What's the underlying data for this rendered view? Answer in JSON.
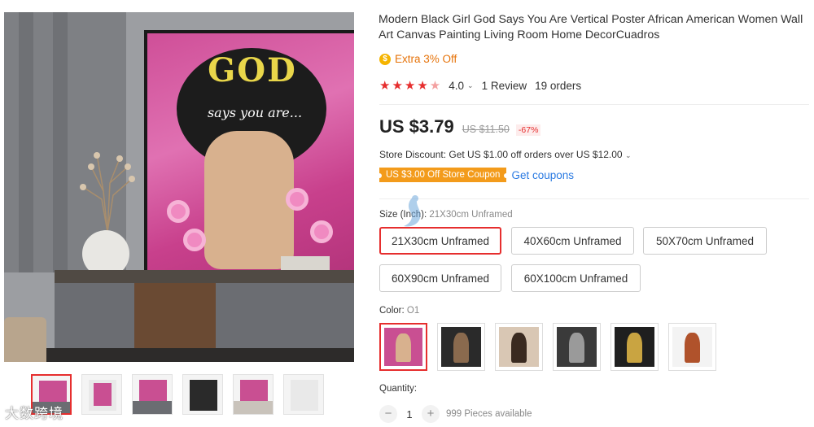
{
  "product": {
    "title": "Modern Black Girl God Says You Are Vertical Poster African American Women Wall Art Canvas Painting Living Room Home DecorCuadros",
    "extra_off": "Extra 3% Off",
    "rating": {
      "stars_value": 4.0,
      "value_label": "4.0",
      "reviews": "1 Review",
      "orders": "19 orders"
    },
    "price": {
      "current": "US $3.79",
      "original": "US $11.50",
      "discount": "-67%"
    },
    "store_discount": "Store Discount: Get US $1.00 off orders over US $12.00",
    "coupon_badge": "US $3.00 Off Store Coupon",
    "get_coupons": "Get coupons"
  },
  "poster_text": {
    "headline": "GOD",
    "subline": "says you are..."
  },
  "size": {
    "label": "Size (Inch):",
    "selected": "21X30cm Unframed",
    "options": [
      "21X30cm Unframed",
      "40X60cm Unframed",
      "50X70cm Unframed",
      "60X90cm Unframed",
      "60X100cm Unframed"
    ]
  },
  "color": {
    "label": "Color:",
    "selected": "O1",
    "swatch_colors": [
      "#c94f92",
      "#2a2a2a",
      "#d9c7b4",
      "#3a3a3a",
      "#1f1f1f",
      "#f3f3f3"
    ]
  },
  "quantity": {
    "label": "Quantity:",
    "value": "1",
    "minus": "−",
    "plus": "+",
    "available": "999 Pieces available"
  },
  "watermark": "大数跨境",
  "colors": {
    "accent_red": "#e62e2e",
    "orange": "#e6730a",
    "coupon_orange": "#f39b1b",
    "link_blue": "#2a7ae2"
  }
}
